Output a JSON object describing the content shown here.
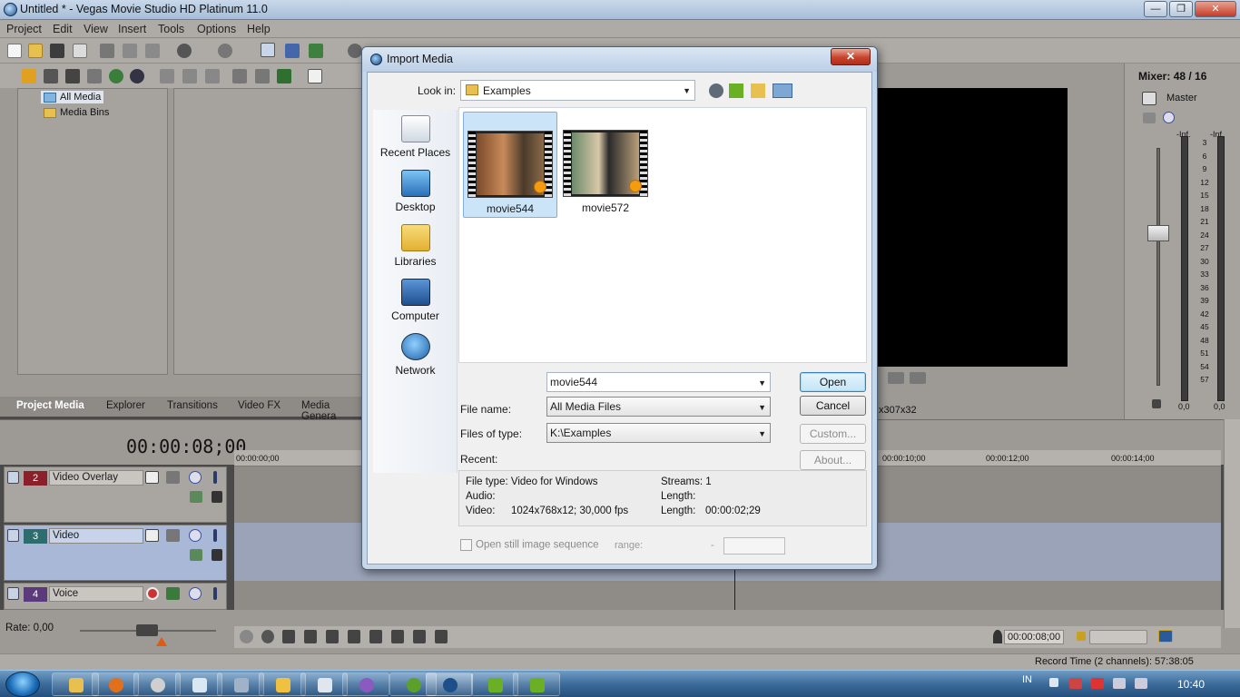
{
  "window": {
    "title": "Untitled * - Vegas Movie Studio HD Platinum 11.0",
    "controls": {
      "minimize": "—",
      "maximize": "❐",
      "close": "✕"
    }
  },
  "menu": [
    "Project",
    "Edit",
    "View",
    "Insert",
    "Tools",
    "Options",
    "Help"
  ],
  "media_tree": {
    "items": [
      "All Media",
      "Media Bins"
    ]
  },
  "left_tabs": [
    "Project Media",
    "Explorer",
    "Transitions",
    "Video FX",
    "Media Genera"
  ],
  "preview": {
    "info": "x307x32"
  },
  "mixer": {
    "title": "Mixer:",
    "value": "48 / 16",
    "master": "Master",
    "inf_left": "-Inf.",
    "inf_right": "-Inf.",
    "scale": [
      "3",
      "6",
      "9",
      "12",
      "15",
      "18",
      "21",
      "24",
      "27",
      "30",
      "33",
      "36",
      "39",
      "42",
      "45",
      "48",
      "51",
      "54",
      "57"
    ],
    "val_left": "0,0",
    "val_right": "0,0"
  },
  "timeline": {
    "timecode": "00:00:08;00",
    "ruler": [
      "00:00:00;00",
      "00:00:10;00",
      "00:00:12;00",
      "00:00:14;00"
    ],
    "tracks": [
      {
        "num": "2",
        "name": "Video Overlay",
        "color": "#8b1f2a"
      },
      {
        "num": "3",
        "name": "Video",
        "color": "#2d6d6e"
      },
      {
        "num": "4",
        "name": "Voice",
        "color": "#5a3a7a"
      }
    ],
    "rate": "Rate: 0,00",
    "transport_timecode": "00:00:08;00",
    "record_time": "Record Time (2 channels): 57:38:05"
  },
  "taskbar": {
    "language": "IN",
    "clock": "10:40"
  },
  "dialog": {
    "title": "Import Media",
    "close": "✕",
    "look_in_label": "Look in:",
    "look_in_value": "Examples",
    "places": [
      "Recent Places",
      "Desktop",
      "Libraries",
      "Computer",
      "Network"
    ],
    "files": [
      {
        "name": "movie544",
        "selected": true
      },
      {
        "name": "movie572",
        "selected": false
      }
    ],
    "file_name_label": "File name:",
    "file_name_value": "movie544",
    "files_of_type_label": "Files of type:",
    "files_of_type_value": "All Media Files",
    "recent_label": "Recent:",
    "recent_value": "K:\\Examples",
    "buttons": {
      "open": "Open",
      "cancel": "Cancel",
      "custom": "Custom...",
      "about": "About..."
    },
    "info": {
      "file_type": "File type: Video for Windows",
      "audio": "Audio:",
      "video_label": "Video:",
      "video_value": "1024x768x12; 30,000 fps",
      "streams": "Streams:  1",
      "length_label": "Length:",
      "length2_label": "Length:",
      "length2_value": "00:00:02;29"
    },
    "still_sequence": "Open still image sequence",
    "range_label": "range:",
    "range_dash": "-"
  }
}
